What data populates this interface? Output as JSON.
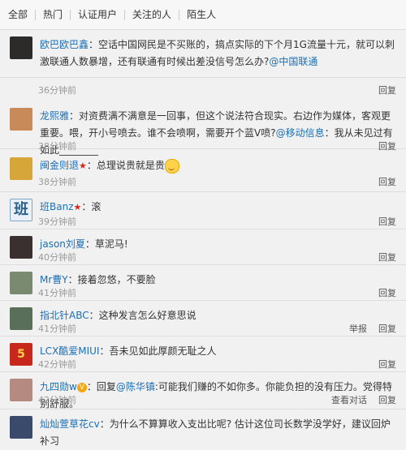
{
  "tabs": [
    "全部",
    "热门",
    "认证用户",
    "关注的人",
    "陌生人"
  ],
  "comments": [
    {
      "name": "欧巴欧巴鑫",
      "text": "：空话中国网民是不买账的，搞点实际的下个月1G流量十元，就可以刺激联通人数暴增，还有联通有时候出差没信号怎么办?",
      "mention": "@中国联通",
      "time": "36分钟前",
      "actions": [
        "回复"
      ]
    },
    {
      "name": "龙熙雅",
      "text": "：对资费满不满意是一回事，但这个说法符合现实。右边作为媒体，客观更重要。喂，开小号喷去。谁不会喷啊，需要开个蓝V喷?",
      "mention": "@移动信息",
      "text2": "：我从未见过有如此________",
      "time": "38分钟前",
      "actions": [
        "回复"
      ]
    },
    {
      "name": "闽金则退",
      "text": "：总理说贵就是贵",
      "time": "38分钟前",
      "actions": [
        "回复"
      ]
    },
    {
      "name": "班Banz",
      "text": "：滚",
      "time": "39分钟前",
      "actions": [
        "回复"
      ]
    },
    {
      "name": "jason刘夏",
      "text": "：草泥马!",
      "time": "40分钟前",
      "actions": [
        "回复"
      ]
    },
    {
      "name": "Mr曹Y",
      "text": "：接着忽悠，不要脸",
      "time": "41分钟前",
      "actions": [
        "回复"
      ]
    },
    {
      "name": "指北针ABC",
      "text": "：这种发言怎么好意思说",
      "time": "41分钟前",
      "actions": [
        "举报",
        "回复"
      ]
    },
    {
      "name": "LCX酷爱MIUI",
      "text": "：吾未见如此厚颜无耻之人",
      "time": "42分钟前",
      "actions": [
        "回复"
      ]
    },
    {
      "name": "九四勋w",
      "text": "：回复",
      "mention": "@陈华镇",
      "text2": ":可能我们赚的不如你多。你能负担的没有压力。党得特别舒服。",
      "time": "42分钟前",
      "actions": [
        "查看对话",
        "回复"
      ]
    },
    {
      "name": "灿灿萱草花cv",
      "text": "：为什么不算算收入支出比呢? 估计这位司长数学没学好，建议回炉补习",
      "time": "",
      "actions": []
    }
  ],
  "avatar_colors": [
    "#2d2a2a",
    "#c98a5a",
    "#d6a63a",
    "#7fa6c8",
    "#3a3030",
    "#7a8a70",
    "#5a6f5a",
    "#c8271c",
    "#b58a80",
    "#3a4a6a"
  ]
}
